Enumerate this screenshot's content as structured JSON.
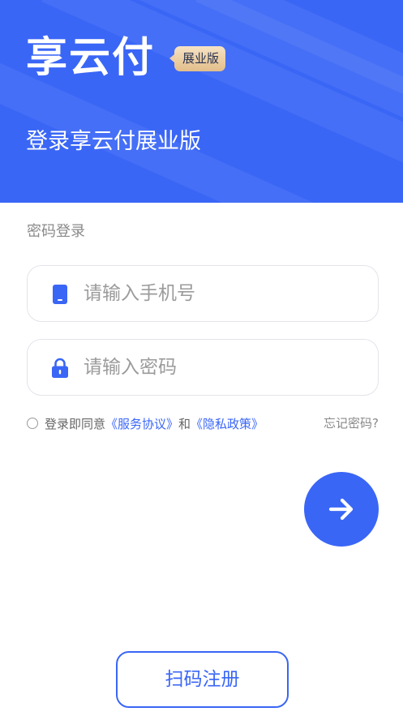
{
  "header": {
    "brand": "享云付",
    "edition_badge": "展业版",
    "title": "登录享云付展业版"
  },
  "form": {
    "section_label": "密码登录",
    "phone": {
      "placeholder": "请输入手机号",
      "value": "",
      "icon": "phone-icon"
    },
    "password": {
      "placeholder": "请输入密码",
      "value": "",
      "icon": "lock-icon"
    },
    "agreement": {
      "prefix": "登录即同意",
      "service_link": "《服务协议》",
      "conjunction": "和",
      "privacy_link": "《隐私政策》"
    },
    "forgot_password": "忘记密码?"
  },
  "actions": {
    "submit_icon": "arrow-right-icon",
    "register_label": "扫码注册"
  },
  "colors": {
    "primary": "#3a66f6",
    "badge_gold": "#e2bd8a",
    "muted_text": "#8a8a8a",
    "field_border": "#e2e4ea"
  }
}
